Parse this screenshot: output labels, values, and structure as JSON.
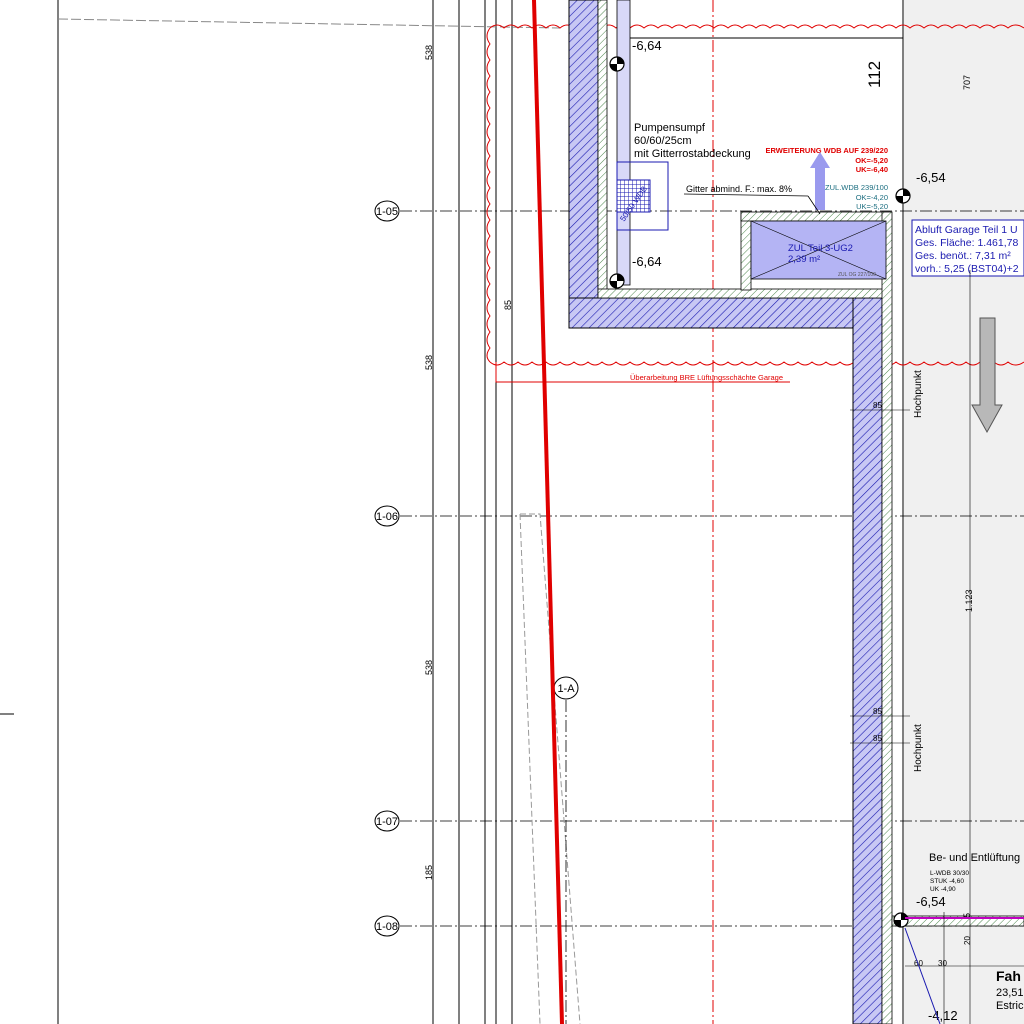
{
  "colors": {
    "line": "#000000",
    "red": "#e00000",
    "blue": "#1a1ab0",
    "teal": "#1c6e80",
    "wall_fill": "#c8c8f4",
    "hatch_green": "#3b7a3b",
    "room_fill": "#b4b4f4",
    "arrow_fill": "#9a9aee",
    "grey_arrow": "#b8b8b8"
  },
  "grid_axes": [
    {
      "label": "1-05"
    },
    {
      "label": "1-06"
    },
    {
      "label": "1-07"
    },
    {
      "label": "1-08"
    }
  ],
  "column_axis": {
    "label": "1-A"
  },
  "dimensions_left": [
    "538",
    "85",
    "538",
    "538",
    "185"
  ],
  "dimensions_right": [
    "707",
    "1.123",
    "5"
  ],
  "dims_small": [
    "85",
    "85",
    "85",
    "60",
    "30",
    "20"
  ],
  "levels": [
    "-6,64",
    "-6,64",
    "-6,54",
    "-6,54",
    "-4,12"
  ],
  "room_number": "112",
  "pump_sump": {
    "line1": "Pumpensumpf",
    "line2": "60/60/25cm",
    "line3": "mit Gitterrostabdeckung",
    "diag_label": "50/50 WDB"
  },
  "grille_note": "Gitter abmind. F.: max. 8%",
  "wdb_extension": {
    "title": "ERWEITERUNG WDB AUF  239/220",
    "ok": "OK=-5,20",
    "uk": "UK=-6,40"
  },
  "wdb_supply": {
    "title": "ZUL.WDB  239/100",
    "ok": "OK=-4,20",
    "uk": "UK=-5,20"
  },
  "exhaust_box": {
    "line1": "Abluft Garage Teil 1 U",
    "line2": "Ges. Fläche: 1.461,78",
    "line3": "Ges. benöt.: 7,31 m²",
    "line4": "vorh.: 5,25 (BST04)+2"
  },
  "supply_room": {
    "label": "ZUL Teil 3-UG2",
    "area": "2,39 m²",
    "small": "ZUL  OG 227/100"
  },
  "revision_note": "Überarbeitung BRE Lüftungsschächte Garage",
  "high_point": "Hochpunkt",
  "ventilation": {
    "title": "Be- und Entlüftung",
    "line1": "L-WDB 30/30",
    "line2": "STUK -4,60",
    "line3": "UK -4,90"
  },
  "bottom_room": {
    "title": "Fah",
    "line1": "23,51",
    "line2": "Estric"
  }
}
